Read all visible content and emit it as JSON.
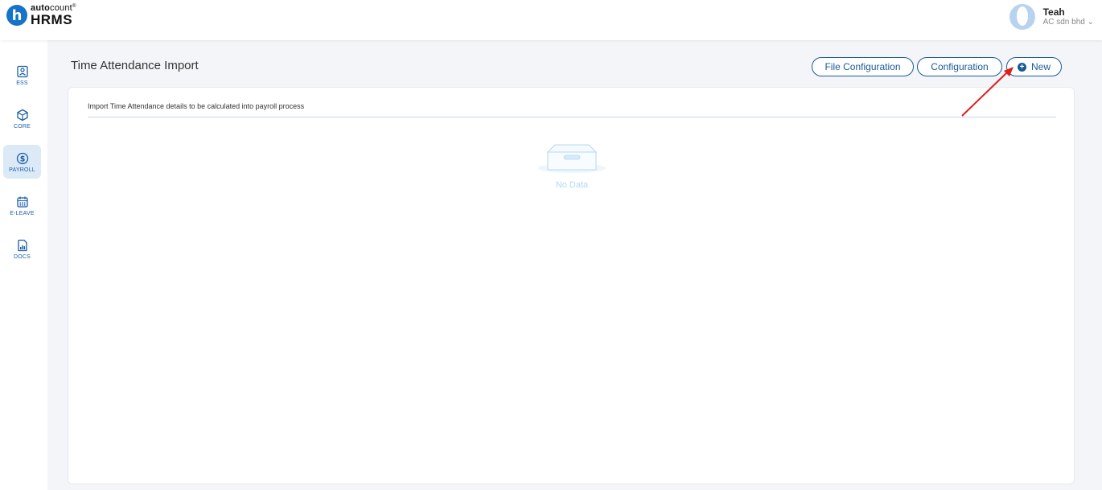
{
  "app": {
    "logo_top": "auto",
    "logo_top_rest": "count",
    "logo_sup": "®",
    "logo_bottom": "HRMS",
    "logo_letter": "h"
  },
  "user": {
    "name": "Teah",
    "company": "AC sdn bhd ⌄"
  },
  "sidebar": {
    "items": [
      {
        "label": "ESS",
        "icon": "ess-icon"
      },
      {
        "label": "CORE",
        "icon": "cube-icon"
      },
      {
        "label": "PAYROLL",
        "icon": "dollar-circle-icon",
        "active": true
      },
      {
        "label": "E-LEAVE",
        "icon": "calendar-icon"
      },
      {
        "label": "DOCS",
        "icon": "document-chart-icon"
      }
    ]
  },
  "page": {
    "title": "Time Attendance Import",
    "buttons": {
      "file_configuration": "File Configuration",
      "configuration": "Configuration",
      "new": "New"
    },
    "description": "Import Time Attendance details to be calculated into payroll process",
    "empty_text": "No Data"
  },
  "colors": {
    "accent": "#1b5a97",
    "sidebar_active_bg": "#dce9f7",
    "annotation_arrow": "#e01e1e"
  }
}
